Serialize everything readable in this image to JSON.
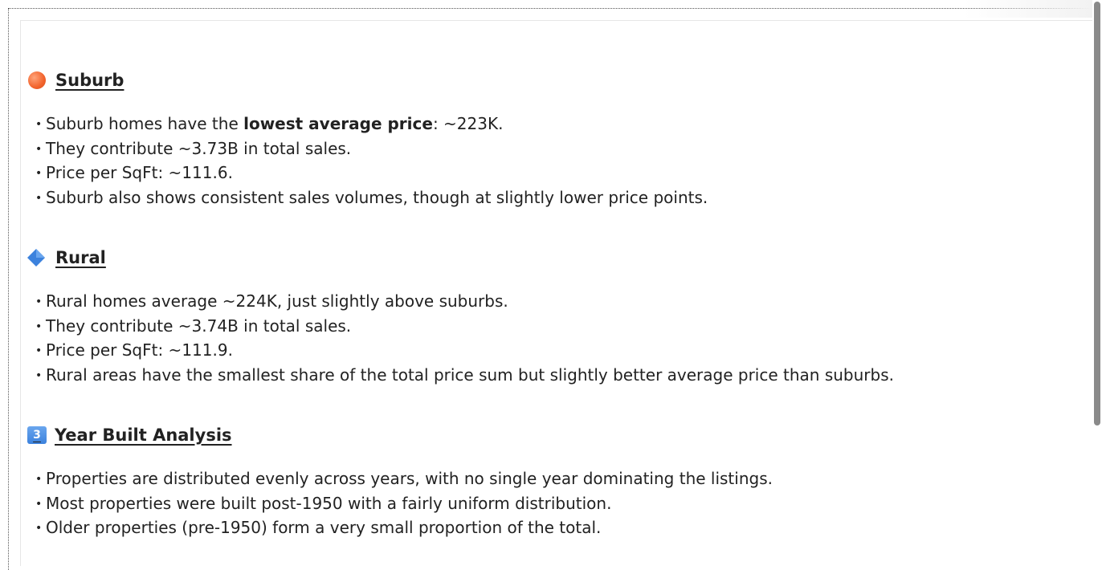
{
  "sections": {
    "suburb": {
      "heading": "Suburb",
      "icon": "orange-circle-icon",
      "bullets": [
        {
          "pre": "Suburb homes have the ",
          "bold": "lowest average price",
          "post": ": ~223K."
        },
        {
          "pre": "They contribute ~3.73B in total sales.",
          "bold": "",
          "post": ""
        },
        {
          "pre": "Price per SqFt: ~111.6.",
          "bold": "",
          "post": ""
        },
        {
          "pre": "Suburb also shows consistent sales volumes, though at slightly lower price points.",
          "bold": "",
          "post": ""
        }
      ]
    },
    "rural": {
      "heading": "Rural",
      "icon": "blue-diamond-icon",
      "bullets": [
        {
          "pre": "Rural homes average ~224K, just slightly above suburbs.",
          "bold": "",
          "post": ""
        },
        {
          "pre": "They contribute ~3.74B in total sales.",
          "bold": "",
          "post": ""
        },
        {
          "pre": "Price per SqFt: ~111.9.",
          "bold": "",
          "post": ""
        },
        {
          "pre": "Rural areas have the smallest share of the total price sum but slightly better average price than suburbs.",
          "bold": "",
          "post": ""
        }
      ]
    },
    "year_built": {
      "heading": "Year Built Analysis",
      "icon": "keycap-3-icon",
      "icon_text": "3",
      "bullets": [
        {
          "pre": "Properties are distributed evenly across years, with no single year dominating the listings.",
          "bold": "",
          "post": ""
        },
        {
          "pre": "Most properties were built post-1950 with a fairly uniform distribution.",
          "bold": "",
          "post": ""
        },
        {
          "pre": "Older properties (pre-1950) form a very small proportion of the total.",
          "bold": "",
          "post": ""
        }
      ]
    }
  },
  "bullet_char": "•",
  "colors": {
    "text": "#222222",
    "orange_icon": "#f2632c",
    "blue_icon": "#3c82dd",
    "scrollbar_thumb": "#8a8a8a"
  }
}
